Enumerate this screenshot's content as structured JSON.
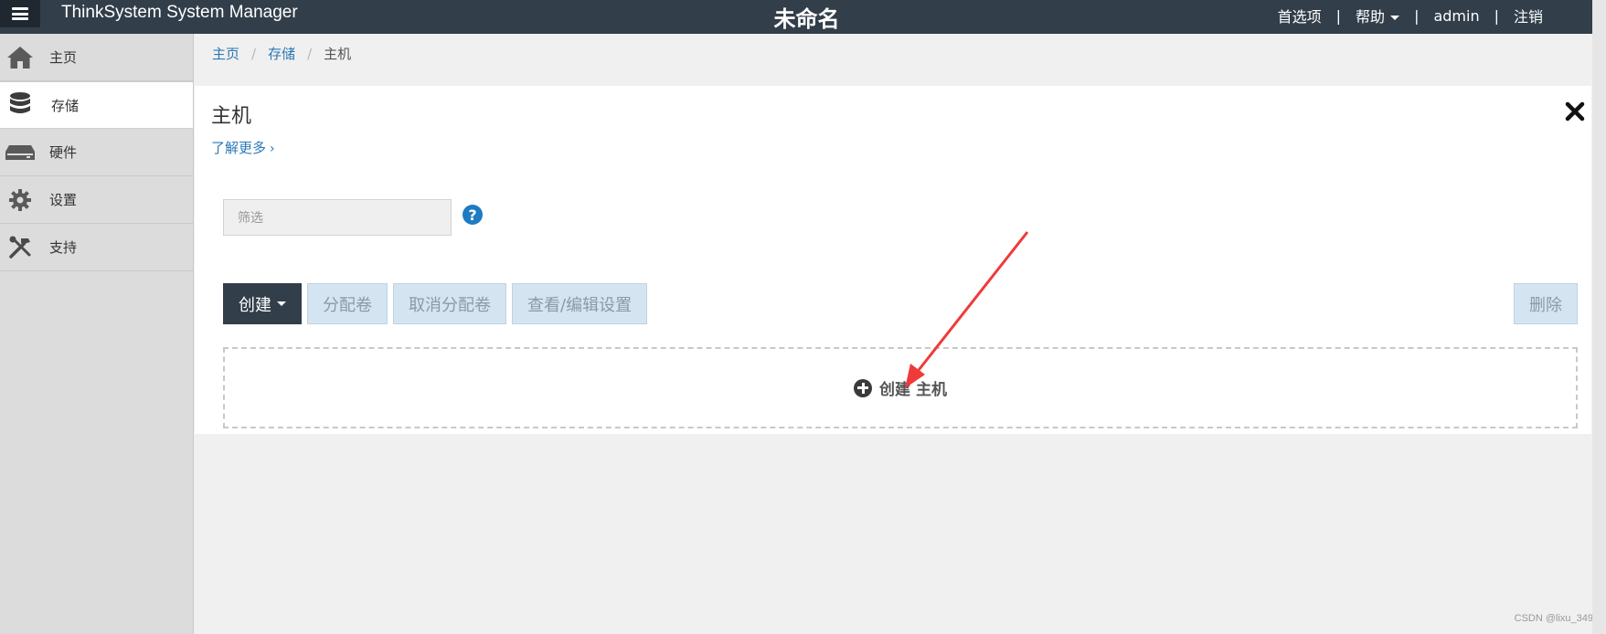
{
  "header": {
    "app_title": "ThinkSystem System Manager",
    "center_title": "未命名",
    "nav": {
      "preferences": "首选项",
      "help": "帮助",
      "user": "admin",
      "logout": "注销",
      "separator": "|"
    }
  },
  "sidebar": {
    "items": [
      {
        "label": "主页",
        "icon": "home-icon"
      },
      {
        "label": "存储",
        "icon": "database-icon",
        "active": true
      },
      {
        "label": "硬件",
        "icon": "server-icon"
      },
      {
        "label": "设置",
        "icon": "gear-icon"
      },
      {
        "label": "支持",
        "icon": "tools-icon"
      }
    ]
  },
  "breadcrumb": {
    "items": [
      "主页",
      "存储",
      "主机"
    ],
    "separator": "/"
  },
  "panel": {
    "title": "主机",
    "learn_more": "了解更多",
    "learn_more_chevron": "›",
    "filter_placeholder": "筛选",
    "help_symbol": "?",
    "toolbar": {
      "create": "创建",
      "assign_volume": "分配卷",
      "unassign_volume": "取消分配卷",
      "view_edit_settings": "查看/编辑设置",
      "delete": "删除"
    },
    "dropzone": {
      "word1": "创建",
      "word2": "主机"
    }
  },
  "colors": {
    "topbar": "#323e4a",
    "link": "#2b78b6",
    "help_icon": "#1f7bc1",
    "annotation_arrow": "#f03a3a"
  },
  "watermark": "CSDN @lixu_349"
}
